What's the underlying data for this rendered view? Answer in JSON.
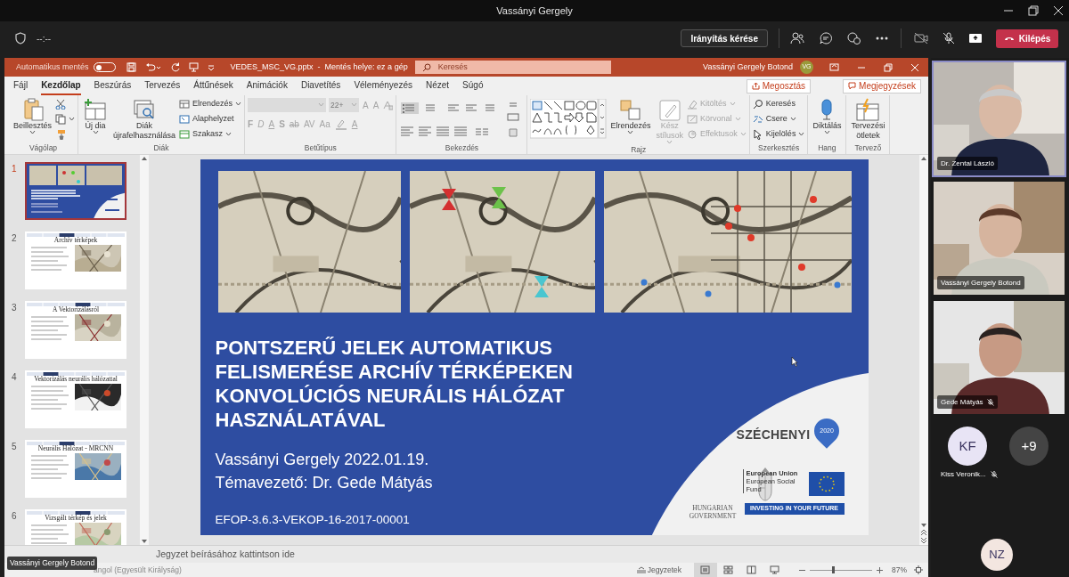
{
  "window": {
    "title": "Vassányi Gergely"
  },
  "meeting_bar": {
    "timer": "--:--",
    "control_button": "Irányítás kérése",
    "leave_button": "Kilépés"
  },
  "powerpoint": {
    "autosave": {
      "label": "Automatikus mentés",
      "on": false
    },
    "file_title": "VEDES_MSC_VG.pptx  -  Mentés helye: ez a gép",
    "search": {
      "placeholder": "Keresés"
    },
    "user": {
      "name": "Vassányi Gergely Botond",
      "initials": "VG"
    },
    "tabs": [
      {
        "label": "Fájl",
        "selected": false
      },
      {
        "label": "Kezdőlap",
        "selected": true
      },
      {
        "label": "Beszúrás",
        "selected": false
      },
      {
        "label": "Tervezés",
        "selected": false
      },
      {
        "label": "Áttűnések",
        "selected": false
      },
      {
        "label": "Animációk",
        "selected": false
      },
      {
        "label": "Diavetítés",
        "selected": false
      },
      {
        "label": "Véleményezés",
        "selected": false
      },
      {
        "label": "Nézet",
        "selected": false
      },
      {
        "label": "Súgó",
        "selected": false
      }
    ],
    "share_button": "Megosztás",
    "comments_button": "Megjegyzések",
    "ribbon": [
      {
        "label": "Vágólap",
        "items": [
          {
            "kind": "large",
            "label": "Beillesztés",
            "caret": true,
            "disabled": false
          },
          {
            "kind": "icon",
            "disabled": false
          },
          {
            "kind": "icon",
            "caret": true,
            "disabled": false
          },
          {
            "kind": "icon",
            "disabled": false
          }
        ]
      },
      {
        "label": "Diák",
        "items": [
          {
            "kind": "large",
            "label": "Új dia",
            "caret": true,
            "disabled": false
          },
          {
            "kind": "large",
            "label": "Diák\nújrafelhasználása",
            "disabled": false
          },
          {
            "kind": "small",
            "label": "Elrendezés",
            "caret": true,
            "disabled": false
          },
          {
            "kind": "small",
            "label": "Alaphelyzet",
            "disabled": false
          },
          {
            "kind": "small",
            "label": "Szakasz",
            "caret": true,
            "disabled": false
          }
        ]
      },
      {
        "label": "Betűtípus",
        "items": [
          {
            "kind": "font_controls",
            "size": "22+",
            "grow_buttons": [
              "A",
              "A"
            ],
            "buttons": [
              "F",
              "D",
              "A",
              "S",
              "ab",
              "AV",
              "Aa"
            ],
            "color_button": "A",
            "disabled": true
          }
        ]
      },
      {
        "label": "Bekezdés",
        "items": [
          {
            "kind": "paragraph_controls",
            "disabled": false
          }
        ]
      },
      {
        "label": "Rajz",
        "items": [
          {
            "kind": "shape_gallery",
            "disabled": false
          },
          {
            "kind": "large",
            "label": "Elrendezés",
            "caret": true,
            "disabled": false
          },
          {
            "kind": "large",
            "label": "Kész\nstílusok",
            "caret": true,
            "disabled": true
          },
          {
            "kind": "small",
            "label": "Kitöltés",
            "caret": true,
            "disabled": true
          },
          {
            "kind": "small",
            "label": "Körvonal",
            "caret": true,
            "disabled": true
          },
          {
            "kind": "small",
            "label": "Effektusok",
            "caret": true,
            "disabled": true
          }
        ]
      },
      {
        "label": "Szerkesztés",
        "items": [
          {
            "kind": "small",
            "label": "Keresés",
            "disabled": false
          },
          {
            "kind": "small",
            "label": "Csere",
            "caret": true,
            "disabled": false
          },
          {
            "kind": "small",
            "label": "Kijelölés",
            "caret": true,
            "disabled": false
          }
        ]
      },
      {
        "label": "Hang",
        "items": [
          {
            "kind": "large",
            "label": "Diktálás",
            "caret": true,
            "disabled": false
          }
        ]
      },
      {
        "label": "Tervező",
        "items": [
          {
            "kind": "large",
            "label": "Tervezési\nötletek",
            "disabled": false
          }
        ]
      }
    ],
    "thumbnails": [
      {
        "number": "1",
        "kind": "title",
        "selected": true
      },
      {
        "number": "2",
        "kind": "content",
        "title": "Archív térképek",
        "selected": false
      },
      {
        "number": "3",
        "kind": "content",
        "title": "A Vektorizálásról",
        "selected": false
      },
      {
        "number": "4",
        "kind": "content",
        "title": "Vektorizálás neurális hálózattal",
        "selected": false
      },
      {
        "number": "5",
        "kind": "content",
        "title": "Neurális Hálózat - MRCNN",
        "selected": false
      },
      {
        "number": "6",
        "kind": "content",
        "title": "Vizsgált térkép és jelek",
        "selected": false
      }
    ],
    "slide": {
      "title": "PONTSZERŰ JELEK AUTOMATIKUS\nFELISMERÉSE ARCHÍV TÉRKÉPEKEN\nKONVOLÚCIÓS NEURÁLIS HÁLÓZAT\nHASZNÁLATÁVAL",
      "subtitle_lines": [
        "Vassányi Gergely 2022.01.19.",
        "Témavezető: Dr. Gede Mátyás"
      ],
      "project_code": "EFOP-3.6.3-VEKOP-16-2017-00001",
      "logos": {
        "program": "SZÉCHENYI",
        "program_year": "2020",
        "government": "HUNGARIAN\nGOVERNMENT",
        "eu_title": "European Union",
        "eu_fund": "European Social\nFund",
        "eu_slogan": "INVESTING IN YOUR FUTURE"
      }
    },
    "notes_placeholder": "Jegyzet beírásához kattintson ide",
    "status_bar": {
      "language": "angol (Egyesült Királyság)",
      "notes_button": "Jegyzetek",
      "views": [
        {
          "selected": true
        },
        {
          "selected": false
        },
        {
          "selected": false
        },
        {
          "selected": false
        }
      ],
      "zoom": {
        "level": 0.38
      },
      "zoom_label": "87%"
    }
  },
  "participants": [
    {
      "name": "Dr. Zentai László",
      "selected": true,
      "muted": false
    },
    {
      "name": "Vassányi Gergely Botond",
      "selected": false,
      "muted": false
    },
    {
      "name": "Gede Mátyás",
      "selected": false,
      "muted": true
    }
  ],
  "avatars": [
    {
      "kind": "person",
      "initials": "KF",
      "name": "Kiss Veronik...",
      "muted": true,
      "color": "#e8e4f5"
    },
    {
      "kind": "overflow",
      "initials": "+9",
      "color": "#444444"
    },
    {
      "kind": "person",
      "initials": "NZ",
      "color": "#f3e6e0"
    }
  ],
  "name_overlay": "Vassányi Gergely Botond"
}
